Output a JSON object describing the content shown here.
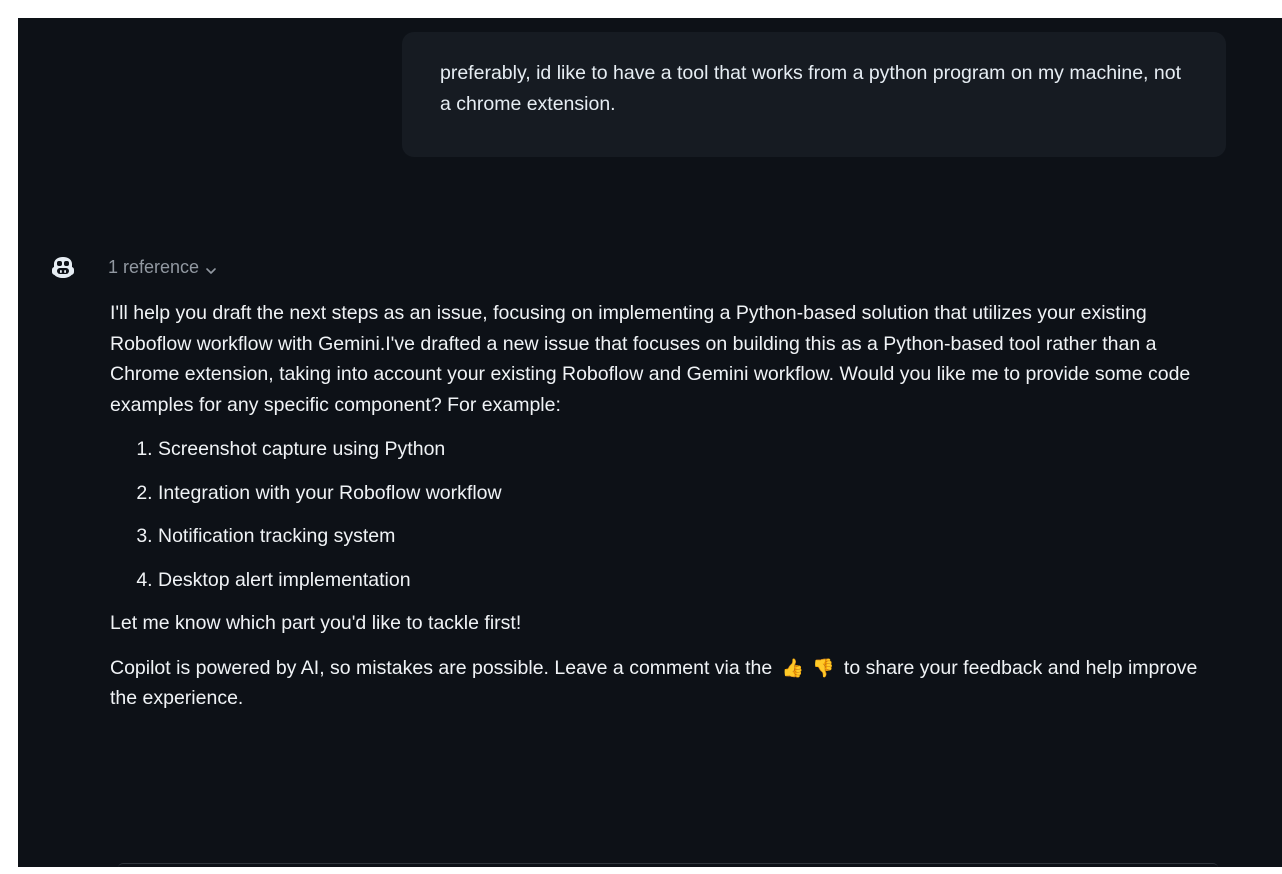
{
  "user_message": {
    "text": "preferably, id like to have a tool that works from a python program on my machine, not a chrome extension."
  },
  "assistant": {
    "icon": "copilot-icon",
    "reference_label": "1 reference",
    "intro": "I'll help you draft the next steps as an issue, focusing on implementing a Python-based solution that utilizes your existing Roboflow workflow with Gemini.I've drafted a new issue that focuses on building this as a Python-based tool rather than a Chrome extension, taking into account your existing Roboflow and Gemini workflow. Would you like me to provide some code examples for any specific component? For example:",
    "list": [
      "Screenshot capture using Python",
      "Integration with your Roboflow workflow",
      "Notification tracking system",
      "Desktop alert implementation"
    ],
    "closing": "Let me know which part you'd like to tackle first!",
    "disclaimer": {
      "before": "Copilot is powered by AI, so mistakes are possible. Leave a comment via the ",
      "thumbs_up": "👍",
      "thumbs_down": "👎",
      "after": " to share your feedback and help improve the experience."
    }
  },
  "colors": {
    "background": "#0d1117",
    "user_bubble": "#161b22",
    "text": "#e6edf3",
    "muted": "#9198a1"
  }
}
